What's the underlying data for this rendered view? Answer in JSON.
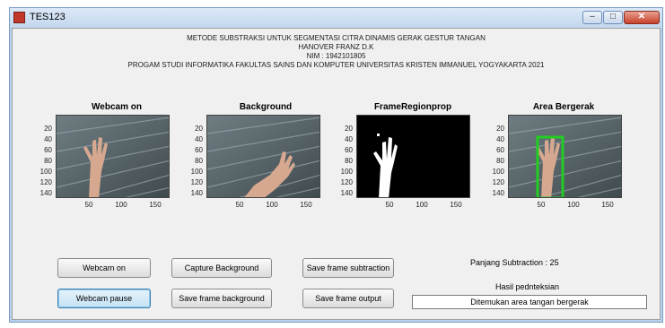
{
  "window": {
    "title": "TES123"
  },
  "header": {
    "line1": "METODE SUBSTRAKSI  UNTUK SEGMENTASI CITRA DINAMIS  GERAK GESTUR TANGAN",
    "line2": "HANOVER FRANZ D.K",
    "line3": "NIM : 1942101805",
    "line4": "PROGAM STUDI INFORMATIKA FAKULTAS SAINS DAN KOMPUTER UNIVERSITAS KRISTEN IMMANUEL YOGYAKARTA 2021"
  },
  "axes_labels": {
    "yticks": [
      "20",
      "40",
      "60",
      "80",
      "100",
      "120",
      "140"
    ],
    "xticks": [
      "50",
      "100",
      "150"
    ]
  },
  "panels": [
    {
      "title": "Webcam on",
      "kind": "camera"
    },
    {
      "title": "Background",
      "kind": "camera"
    },
    {
      "title": "FrameRegionprop",
      "kind": "binary"
    },
    {
      "title": "Area Bergerak",
      "kind": "camera-box"
    }
  ],
  "buttons": {
    "webcam_on": "Webcam on",
    "webcam_pause": "Webcam pause",
    "capture_background": "Capture Background",
    "save_frame_background": "Save frame background",
    "save_frame_subtraction": "Save frame subtraction",
    "save_frame_output": "Save frame output"
  },
  "status": {
    "panjang_subtraction": "Panjang Subtraction : 25",
    "hasil_label": "Hasil pednteksian",
    "hasil_value": "Ditemukan area tangan bergerak"
  },
  "colors": {
    "detection_box": "#22cc22",
    "window_frame": "#b9d1ea"
  }
}
